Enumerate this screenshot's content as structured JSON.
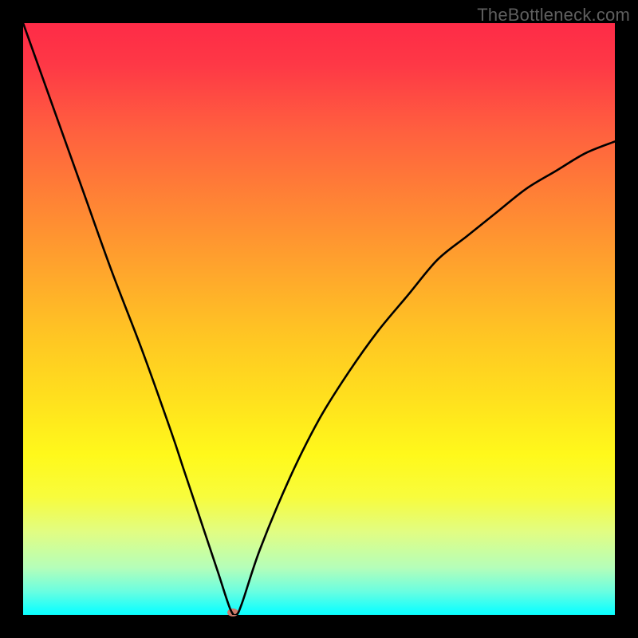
{
  "watermark": "TheBottleneck.com",
  "chart_data": {
    "type": "line",
    "title": "",
    "xlabel": "",
    "ylabel": "",
    "xlim": [
      0,
      100
    ],
    "ylim": [
      0,
      100
    ],
    "x": [
      0,
      5,
      10,
      15,
      20,
      25,
      27,
      29,
      31,
      33,
      35,
      36,
      37,
      40,
      45,
      50,
      55,
      60,
      65,
      70,
      75,
      80,
      85,
      90,
      95,
      100
    ],
    "values": [
      100,
      86,
      72,
      58,
      45,
      31,
      25,
      19,
      13,
      7,
      1,
      0,
      2,
      11,
      23,
      33,
      41,
      48,
      54,
      60,
      64,
      68,
      72,
      75,
      78,
      80
    ],
    "marker": {
      "x": 35.5,
      "y": 0,
      "color": "#cf7b6b"
    },
    "gradient_stops": [
      {
        "pos": 0,
        "color": "#fe2b47"
      },
      {
        "pos": 7,
        "color": "#fe3846"
      },
      {
        "pos": 18,
        "color": "#ff5f3f"
      },
      {
        "pos": 30,
        "color": "#ff8335"
      },
      {
        "pos": 42,
        "color": "#ffa62c"
      },
      {
        "pos": 53,
        "color": "#ffc623"
      },
      {
        "pos": 65,
        "color": "#ffe41d"
      },
      {
        "pos": 73,
        "color": "#fff91b"
      },
      {
        "pos": 80,
        "color": "#f8fc3c"
      },
      {
        "pos": 86,
        "color": "#e1fd83"
      },
      {
        "pos": 92,
        "color": "#b5feb9"
      },
      {
        "pos": 96,
        "color": "#6bfee0"
      },
      {
        "pos": 99,
        "color": "#1dfffa"
      },
      {
        "pos": 100,
        "color": "#0bffff"
      }
    ]
  }
}
